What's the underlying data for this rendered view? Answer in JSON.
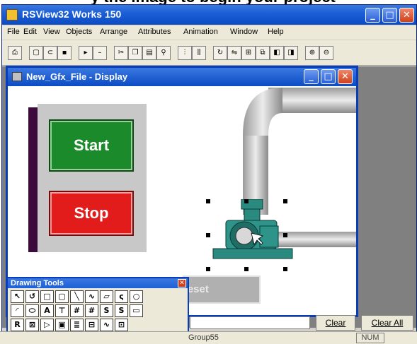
{
  "app": {
    "title": "RSView32 Works 150",
    "menus": [
      "File",
      "Edit",
      "View",
      "Objects",
      "Arrange",
      "Attributes",
      "Animation",
      "Window",
      "Help"
    ]
  },
  "display": {
    "title": "New_Gfx_File - Display",
    "start_label": "Start",
    "stop_label": "Stop",
    "reset_counter_label": "Reset Counter",
    "colors": {
      "start": "#1b8a2a",
      "stop": "#e21b1b",
      "pump": "#2a8a80",
      "pipe": "#c8c8c8"
    }
  },
  "drawing_tools": {
    "title": "Drawing Tools",
    "tools": [
      "select-arrow",
      "freehand",
      "rectangle",
      "rounded-rect",
      "line",
      "polyline",
      "polygon",
      "curve",
      "ellipse",
      "arc",
      "wedge",
      "text",
      "display-text",
      "numeric",
      "numeric-input",
      "string-display",
      "string-input",
      "button",
      "recipe",
      "symbol",
      "message",
      "gauge",
      "ctrl-list",
      "trend",
      "activex"
    ]
  },
  "bottom": {
    "clear_label": "Clear",
    "clear_all_label": "Clear All",
    "status_text": "Group55",
    "num_label": "NUM"
  }
}
